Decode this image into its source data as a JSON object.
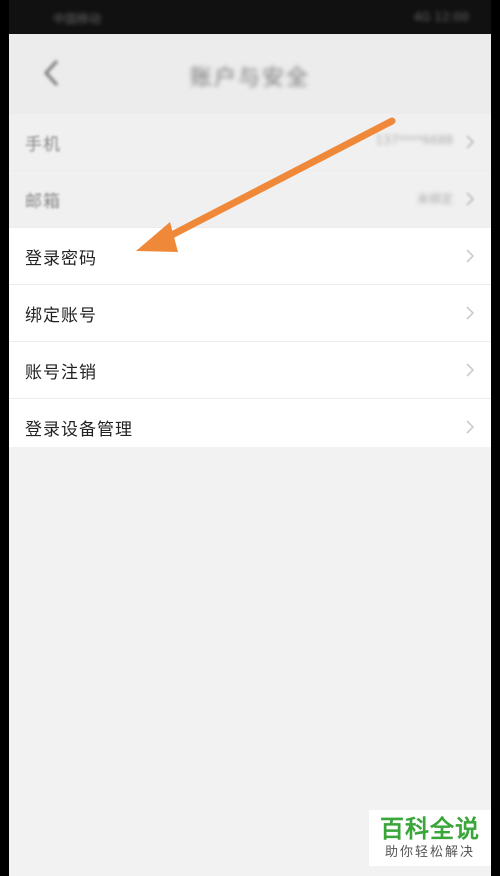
{
  "status_bar": {
    "left_text": "中国移动",
    "right_text": "4G 12:00"
  },
  "header": {
    "back_icon": "chevron-left-icon",
    "title": "账户与安全"
  },
  "settings": {
    "rows": [
      {
        "label": "手机",
        "value": "137****6688"
      },
      {
        "label": "邮箱",
        "value": "未绑定"
      },
      {
        "label": "登录密码",
        "value": ""
      },
      {
        "label": "绑定账号",
        "value": ""
      },
      {
        "label": "账号注销",
        "value": ""
      },
      {
        "label": "登录设备管理",
        "value": ""
      }
    ]
  },
  "annotation": {
    "arrow_color": "#f0883a",
    "points_to": "登录密码"
  },
  "watermark": {
    "title": "百科全说",
    "subtitle": "助你轻松解决",
    "color": "#3aa63a"
  }
}
